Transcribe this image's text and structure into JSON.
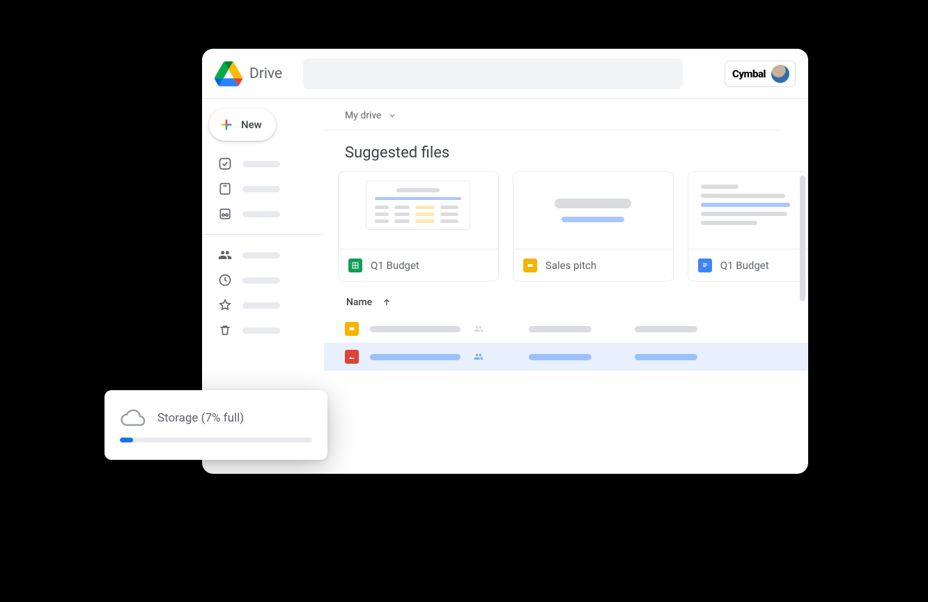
{
  "header": {
    "app_title": "Drive",
    "brand": "Cymbal"
  },
  "sidebar": {
    "new_label": "New"
  },
  "breadcrumb": {
    "label": "My drive"
  },
  "suggested": {
    "title": "Suggested files",
    "cards": [
      {
        "name": "Q1 Budget",
        "type": "sheets"
      },
      {
        "name": "Sales pitch",
        "type": "slides"
      },
      {
        "name": "Q1 Budget",
        "type": "docs"
      }
    ]
  },
  "list": {
    "header_name": "Name"
  },
  "storage": {
    "label": "Storage (7% full)",
    "percent": 7
  }
}
